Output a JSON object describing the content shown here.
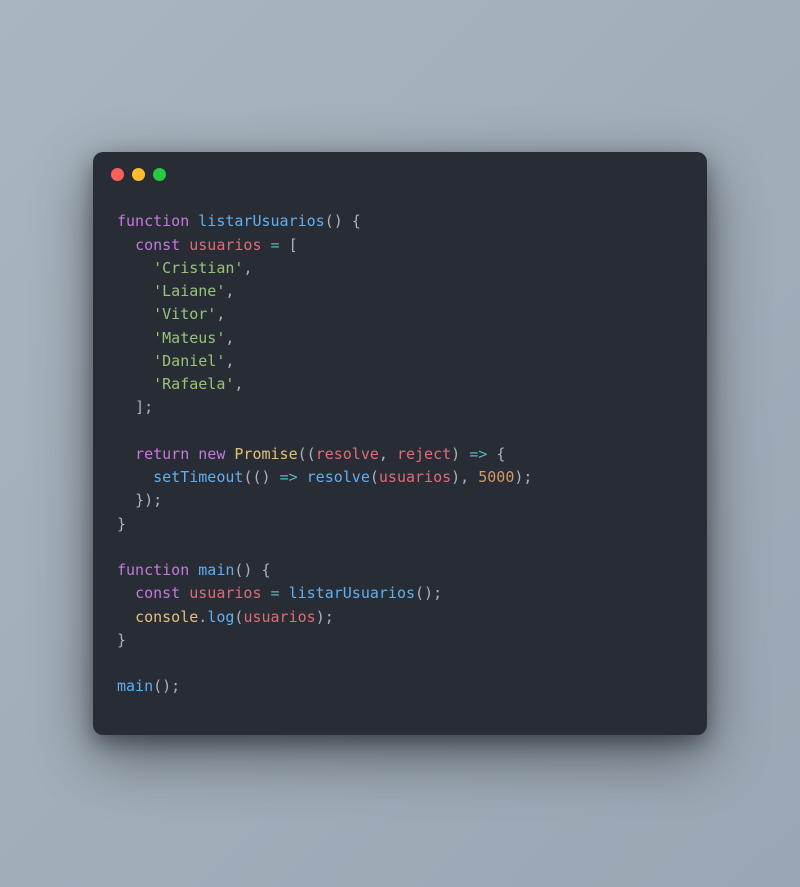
{
  "window": {
    "traffic_lights": [
      "close",
      "minimize",
      "zoom"
    ]
  },
  "code": {
    "fn1_keyword": "function",
    "fn1_name": "listarUsuarios",
    "fn1_open": "() {",
    "const_kw": "const",
    "var_usuarios": "usuarios",
    "eq": "=",
    "arr_open": "[",
    "strings": [
      "'Cristian'",
      "'Laiane'",
      "'Vitor'",
      "'Mateus'",
      "'Daniel'",
      "'Rafaela'"
    ],
    "arr_close": "];",
    "return_kw": "return",
    "new_kw": "new",
    "promise_cls": "Promise",
    "promise_args_open": "((",
    "resolve_id": "resolve",
    "comma_sp": ", ",
    "reject_id": "reject",
    "promise_args_close": ")",
    "arrow": "=>",
    "brace_open": "{",
    "setTimeout_fn": "setTimeout",
    "st_args_open": "(()",
    "resolve_call": "resolve",
    "usuarios_arg": "usuarios",
    "timeout_num": "5000",
    "st_tail": ");",
    "close_brace_paren_semi": "});",
    "close_brace": "}",
    "fn2_keyword": "function",
    "fn2_name": "main",
    "fn2_open": "() {",
    "call_listar": "listarUsuarios",
    "call_tail": "();",
    "console_cls": "console",
    "dot": ".",
    "log_prop": "log",
    "log_open": "(",
    "log_close": ");",
    "main_call": "main",
    "main_call_tail": "();"
  }
}
